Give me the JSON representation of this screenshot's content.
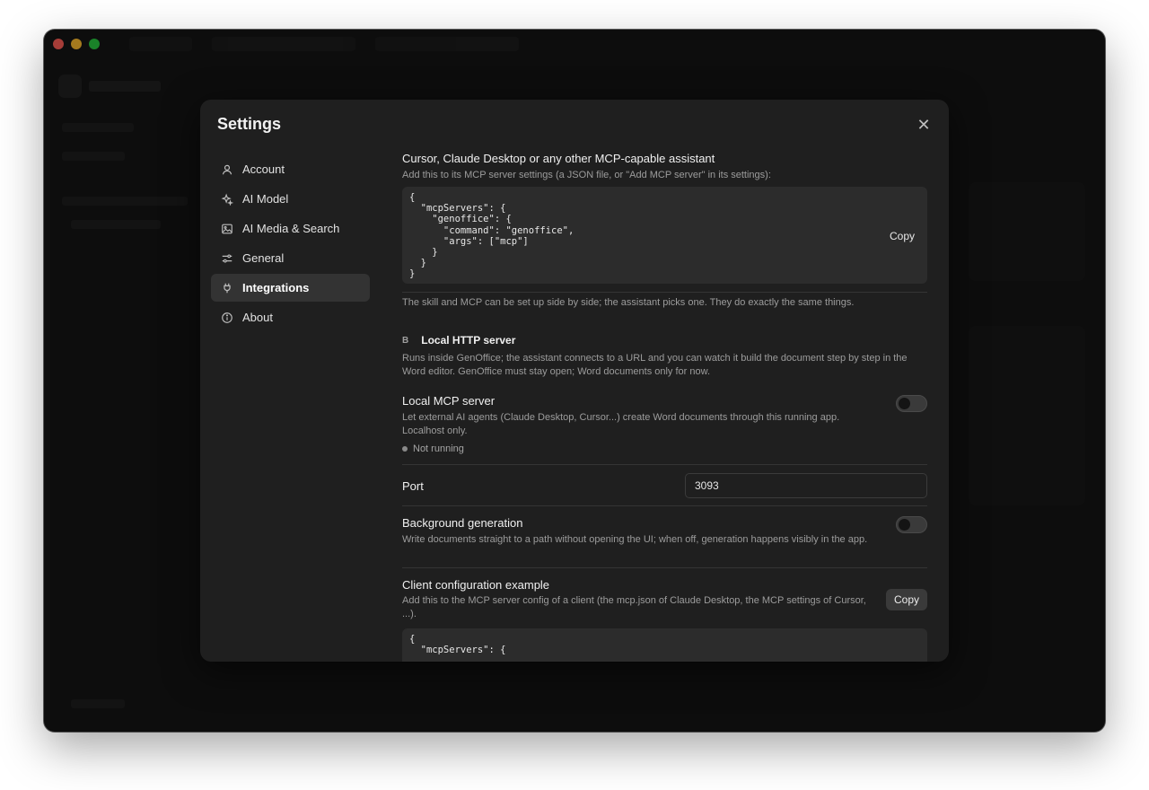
{
  "modal": {
    "title": "Settings",
    "close_icon": "close-icon"
  },
  "nav": {
    "items": [
      {
        "label": "Account",
        "icon": "user-icon"
      },
      {
        "label": "AI Model",
        "icon": "sparkle-icon"
      },
      {
        "label": "AI Media & Search",
        "icon": "image-icon"
      },
      {
        "label": "General",
        "icon": "sliders-icon"
      },
      {
        "label": "Integrations",
        "icon": "plug-icon",
        "active": true
      },
      {
        "label": "About",
        "icon": "info-icon"
      }
    ]
  },
  "mcp_assistant": {
    "heading": "Cursor, Claude Desktop or any other MCP-capable assistant",
    "description": "Add this to its MCP server settings (a JSON file, or \"Add MCP server\" in its settings):",
    "code": "{\n  \"mcpServers\": {\n    \"genoffice\": {\n      \"command\": \"genoffice\",\n      \"args\": [\"mcp\"]\n    }\n  }\n}",
    "copy_label": "Copy",
    "note": "The skill and MCP can be set up side by side; the assistant picks one. They do exactly the same things."
  },
  "section_b": {
    "letter": "B",
    "title": "Local HTTP server",
    "description": "Runs inside GenOffice; the assistant connects to a URL and you can watch it build the document step by step in the Word editor. GenOffice must stay open; Word documents only for now."
  },
  "local_mcp": {
    "label": "Local MCP server",
    "description": "Let external AI agents (Claude Desktop, Cursor...) create Word documents through this running app. Localhost only.",
    "enabled": false,
    "status": "Not running"
  },
  "port": {
    "label": "Port",
    "value": "3093"
  },
  "background_generation": {
    "label": "Background generation",
    "description": "Write documents straight to a path without opening the UI; when off, generation happens visibly in the app.",
    "enabled": false
  },
  "client_config": {
    "label": "Client configuration example",
    "description": "Add this to the MCP server config of a client (the mcp.json of Claude Desktop, the MCP settings of Cursor, ...).",
    "copy_label": "Copy",
    "code": "{\n  \"mcpServers\": {"
  },
  "colors": {
    "modal_bg": "#1f1f1f",
    "active_nav_bg": "#333333",
    "code_bg": "#2c2c2c"
  }
}
